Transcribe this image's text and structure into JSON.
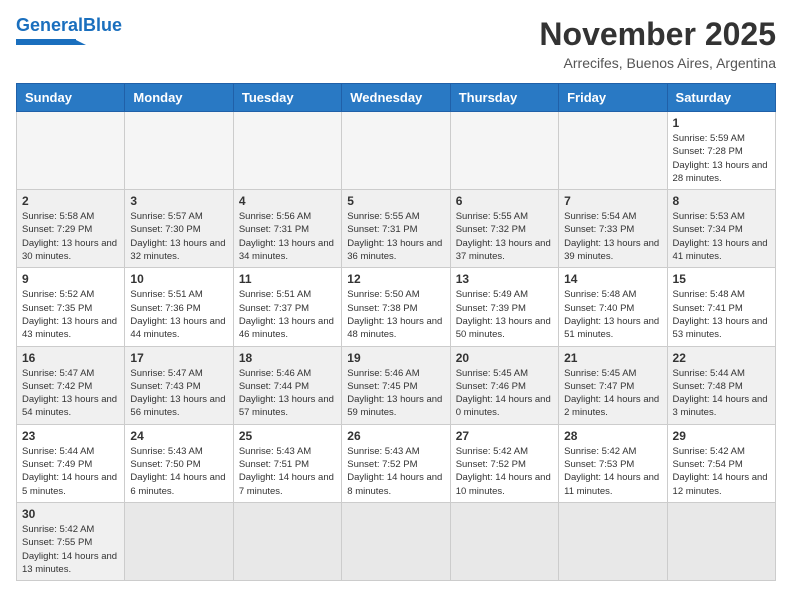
{
  "header": {
    "logo_general": "General",
    "logo_blue": "Blue",
    "month_title": "November 2025",
    "location": "Arrecifes, Buenos Aires, Argentina"
  },
  "weekdays": [
    "Sunday",
    "Monday",
    "Tuesday",
    "Wednesday",
    "Thursday",
    "Friday",
    "Saturday"
  ],
  "weeks": [
    [
      {
        "day": "",
        "info": ""
      },
      {
        "day": "",
        "info": ""
      },
      {
        "day": "",
        "info": ""
      },
      {
        "day": "",
        "info": ""
      },
      {
        "day": "",
        "info": ""
      },
      {
        "day": "",
        "info": ""
      },
      {
        "day": "1",
        "info": "Sunrise: 5:59 AM\nSunset: 7:28 PM\nDaylight: 13 hours and 28 minutes."
      }
    ],
    [
      {
        "day": "2",
        "info": "Sunrise: 5:58 AM\nSunset: 7:29 PM\nDaylight: 13 hours and 30 minutes."
      },
      {
        "day": "3",
        "info": "Sunrise: 5:57 AM\nSunset: 7:30 PM\nDaylight: 13 hours and 32 minutes."
      },
      {
        "day": "4",
        "info": "Sunrise: 5:56 AM\nSunset: 7:31 PM\nDaylight: 13 hours and 34 minutes."
      },
      {
        "day": "5",
        "info": "Sunrise: 5:55 AM\nSunset: 7:31 PM\nDaylight: 13 hours and 36 minutes."
      },
      {
        "day": "6",
        "info": "Sunrise: 5:55 AM\nSunset: 7:32 PM\nDaylight: 13 hours and 37 minutes."
      },
      {
        "day": "7",
        "info": "Sunrise: 5:54 AM\nSunset: 7:33 PM\nDaylight: 13 hours and 39 minutes."
      },
      {
        "day": "8",
        "info": "Sunrise: 5:53 AM\nSunset: 7:34 PM\nDaylight: 13 hours and 41 minutes."
      }
    ],
    [
      {
        "day": "9",
        "info": "Sunrise: 5:52 AM\nSunset: 7:35 PM\nDaylight: 13 hours and 43 minutes."
      },
      {
        "day": "10",
        "info": "Sunrise: 5:51 AM\nSunset: 7:36 PM\nDaylight: 13 hours and 44 minutes."
      },
      {
        "day": "11",
        "info": "Sunrise: 5:51 AM\nSunset: 7:37 PM\nDaylight: 13 hours and 46 minutes."
      },
      {
        "day": "12",
        "info": "Sunrise: 5:50 AM\nSunset: 7:38 PM\nDaylight: 13 hours and 48 minutes."
      },
      {
        "day": "13",
        "info": "Sunrise: 5:49 AM\nSunset: 7:39 PM\nDaylight: 13 hours and 50 minutes."
      },
      {
        "day": "14",
        "info": "Sunrise: 5:48 AM\nSunset: 7:40 PM\nDaylight: 13 hours and 51 minutes."
      },
      {
        "day": "15",
        "info": "Sunrise: 5:48 AM\nSunset: 7:41 PM\nDaylight: 13 hours and 53 minutes."
      }
    ],
    [
      {
        "day": "16",
        "info": "Sunrise: 5:47 AM\nSunset: 7:42 PM\nDaylight: 13 hours and 54 minutes."
      },
      {
        "day": "17",
        "info": "Sunrise: 5:47 AM\nSunset: 7:43 PM\nDaylight: 13 hours and 56 minutes."
      },
      {
        "day": "18",
        "info": "Sunrise: 5:46 AM\nSunset: 7:44 PM\nDaylight: 13 hours and 57 minutes."
      },
      {
        "day": "19",
        "info": "Sunrise: 5:46 AM\nSunset: 7:45 PM\nDaylight: 13 hours and 59 minutes."
      },
      {
        "day": "20",
        "info": "Sunrise: 5:45 AM\nSunset: 7:46 PM\nDaylight: 14 hours and 0 minutes."
      },
      {
        "day": "21",
        "info": "Sunrise: 5:45 AM\nSunset: 7:47 PM\nDaylight: 14 hours and 2 minutes."
      },
      {
        "day": "22",
        "info": "Sunrise: 5:44 AM\nSunset: 7:48 PM\nDaylight: 14 hours and 3 minutes."
      }
    ],
    [
      {
        "day": "23",
        "info": "Sunrise: 5:44 AM\nSunset: 7:49 PM\nDaylight: 14 hours and 5 minutes."
      },
      {
        "day": "24",
        "info": "Sunrise: 5:43 AM\nSunset: 7:50 PM\nDaylight: 14 hours and 6 minutes."
      },
      {
        "day": "25",
        "info": "Sunrise: 5:43 AM\nSunset: 7:51 PM\nDaylight: 14 hours and 7 minutes."
      },
      {
        "day": "26",
        "info": "Sunrise: 5:43 AM\nSunset: 7:52 PM\nDaylight: 14 hours and 8 minutes."
      },
      {
        "day": "27",
        "info": "Sunrise: 5:42 AM\nSunset: 7:52 PM\nDaylight: 14 hours and 10 minutes."
      },
      {
        "day": "28",
        "info": "Sunrise: 5:42 AM\nSunset: 7:53 PM\nDaylight: 14 hours and 11 minutes."
      },
      {
        "day": "29",
        "info": "Sunrise: 5:42 AM\nSunset: 7:54 PM\nDaylight: 14 hours and 12 minutes."
      }
    ],
    [
      {
        "day": "30",
        "info": "Sunrise: 5:42 AM\nSunset: 7:55 PM\nDaylight: 14 hours and 13 minutes."
      },
      {
        "day": "",
        "info": ""
      },
      {
        "day": "",
        "info": ""
      },
      {
        "day": "",
        "info": ""
      },
      {
        "day": "",
        "info": ""
      },
      {
        "day": "",
        "info": ""
      },
      {
        "day": "",
        "info": ""
      }
    ]
  ]
}
